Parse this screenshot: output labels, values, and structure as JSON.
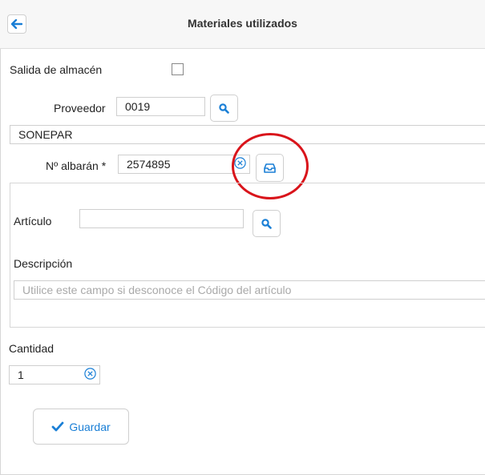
{
  "header": {
    "title": "Materiales utilizados"
  },
  "salida": {
    "label": "Salida de almacén",
    "checked": false
  },
  "proveedor": {
    "label": "Proveedor",
    "value": "0019",
    "name": "SONEPAR"
  },
  "albaran": {
    "label": "Nº albarán *",
    "value": "2574895"
  },
  "articulo": {
    "label": "Artículo",
    "value": ""
  },
  "descripcion": {
    "label": "Descripción",
    "placeholder": "Utilice  este campo si desconoce el Código del artículo"
  },
  "cantidad": {
    "label": "Cantidad",
    "value": "1"
  },
  "actions": {
    "save_label": "Guardar"
  },
  "colors": {
    "accent": "#1a7fd6",
    "highlight": "#d9141b"
  },
  "icons": [
    "arrow-left-icon",
    "search-icon",
    "inbox-icon",
    "clear-icon",
    "check-icon"
  ]
}
